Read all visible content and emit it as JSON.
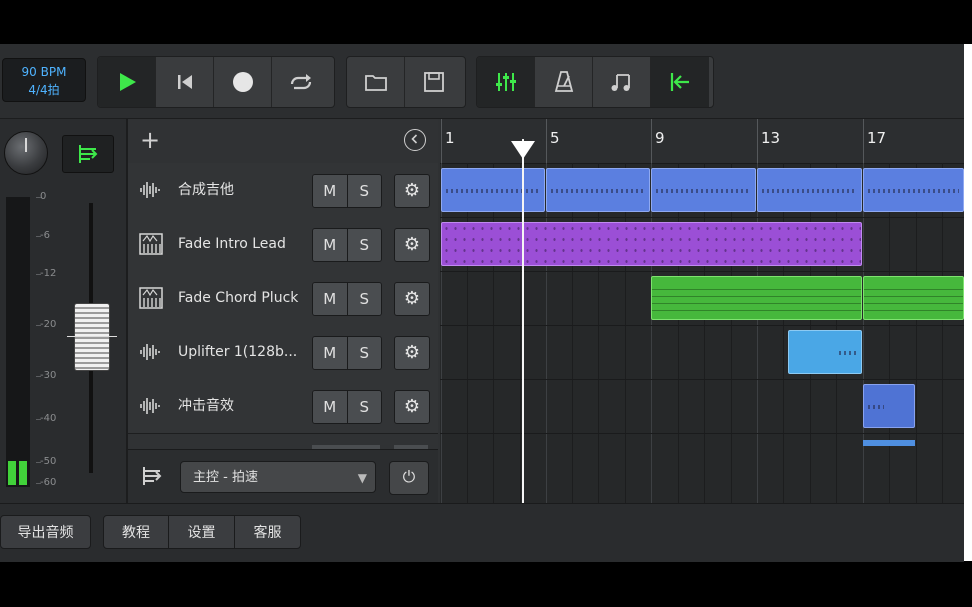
{
  "transport": {
    "bpm": "90 BPM",
    "time_signature": "4/4拍",
    "buttons": [
      "play-icon",
      "rewind-icon",
      "record-icon",
      "loop-icon"
    ],
    "play_color": "#3ee84a"
  },
  "file_buttons": [
    "folder-icon",
    "save-icon"
  ],
  "view_buttons": [
    "mixer-icon",
    "metronome-icon",
    "notes-icon",
    "snap-to-start-icon"
  ],
  "accent_green": "#41d23a",
  "meter_scale": [
    "0",
    "-6",
    "-12",
    "-20",
    "-30",
    "-40",
    "-50",
    "-60"
  ],
  "tracks": [
    {
      "name": "合成吉他",
      "icon": "audio-wave-icon",
      "mute": "M",
      "solo": "S"
    },
    {
      "name": "Fade Intro Lead",
      "icon": "synth-keyboard-icon",
      "mute": "M",
      "solo": "S"
    },
    {
      "name": "Fade Chord Pluck",
      "icon": "synth-keyboard-icon",
      "mute": "M",
      "solo": "S"
    },
    {
      "name": "Uplifter 1(128b...",
      "icon": "audio-wave-icon",
      "mute": "M",
      "solo": "S"
    },
    {
      "name": "冲击音效",
      "icon": "audio-wave-icon",
      "mute": "M",
      "solo": "S"
    }
  ],
  "master": {
    "label": "主控 - 拍速"
  },
  "ruler": [
    "1",
    "5",
    "9",
    "13",
    "17"
  ],
  "bottom": {
    "export": "导出音频",
    "tutorial": "教程",
    "settings": "设置",
    "support": "客服"
  }
}
